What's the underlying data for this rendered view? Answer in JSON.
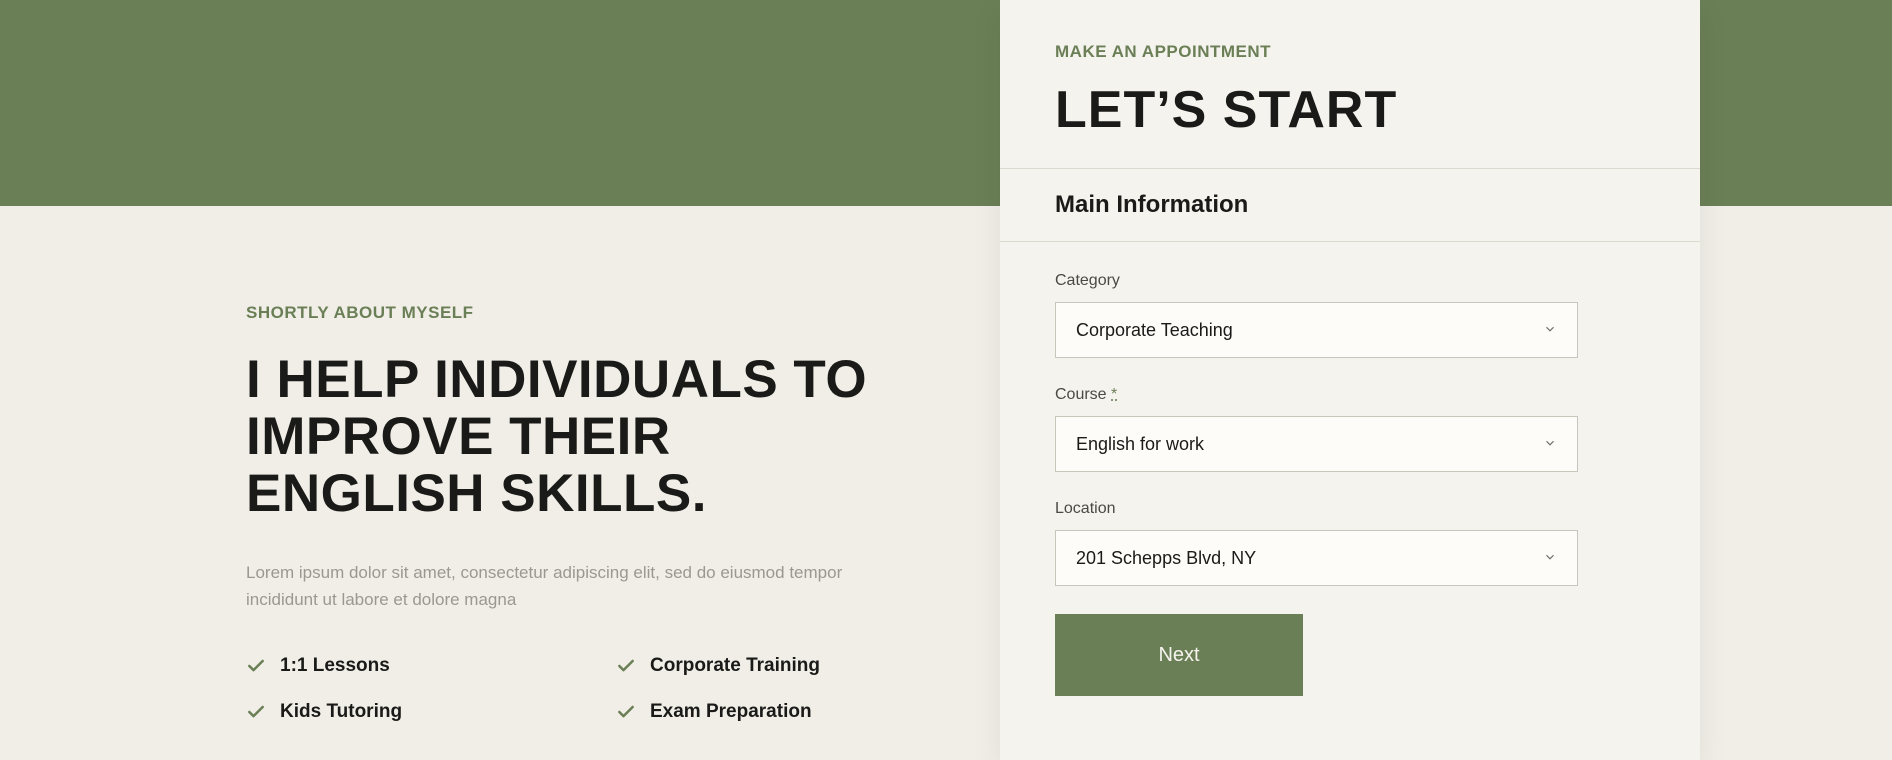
{
  "left": {
    "eyebrow": "SHORTLY ABOUT MYSELF",
    "headline": "I HELP INDIVIDUALS TO IMPROVE THEIR ENGLISH SKILLS.",
    "body": "Lorem ipsum dolor sit amet, consectetur adipiscing elit, sed do eiusmod tempor incididunt ut labore et dolore magna",
    "features": [
      "1:1 Lessons",
      "Corporate Training",
      "Kids Tutoring",
      "Exam Preparation"
    ]
  },
  "card": {
    "eyebrow": "MAKE AN APPOINTMENT",
    "title": "LET’S START",
    "section": "Main Information",
    "fields": {
      "category": {
        "label": "Category",
        "value": "Corporate Teaching"
      },
      "course": {
        "label": "Course",
        "required": "*",
        "value": "English for work"
      },
      "location": {
        "label": "Location",
        "value": "201 Schepps Blvd, NY"
      }
    },
    "next": "Next"
  }
}
